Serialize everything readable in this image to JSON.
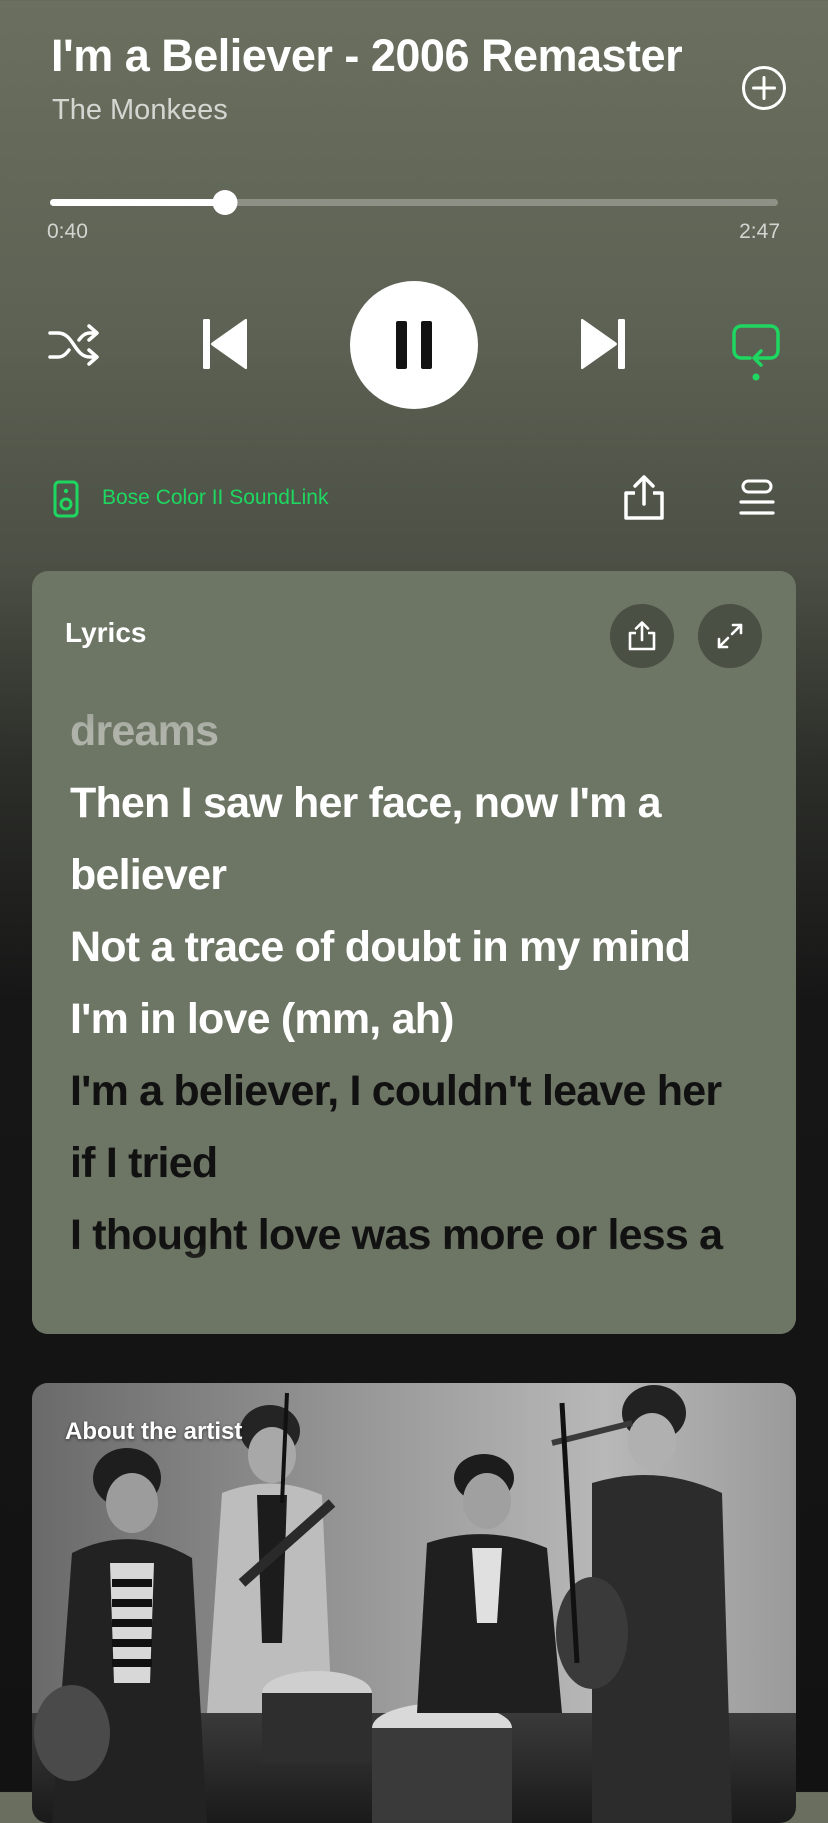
{
  "track": {
    "title": "I'm a Believer - 2006 Remaster",
    "artist": "The Monkees"
  },
  "progress": {
    "elapsed": "0:40",
    "total": "2:47",
    "fraction": 0.24
  },
  "controls": {
    "shuffle_icon": "shuffle-icon",
    "previous_icon": "skip-previous-icon",
    "play_state_icon": "pause-icon",
    "next_icon": "skip-next-icon",
    "repeat_icon": "repeat-icon",
    "repeat_active": true
  },
  "device": {
    "name": "Bose Color II SoundLink",
    "icon": "speaker-icon"
  },
  "lyrics": {
    "title": "Lyrics",
    "lines": [
      {
        "text": "dreams",
        "state": "past"
      },
      {
        "text": "Then I saw her face, now I'm a",
        "state": "sung"
      },
      {
        "text": "believer",
        "state": "sung"
      },
      {
        "text": "Not a trace of doubt in my mind",
        "state": "sung"
      },
      {
        "text": "I'm in love (mm, ah)",
        "state": "sung"
      },
      {
        "text": "I'm a believer, I couldn't leave her",
        "state": "upcoming"
      },
      {
        "text": "if I tried",
        "state": "upcoming"
      },
      {
        "text": "I thought love was more or less a",
        "state": "upcoming"
      }
    ]
  },
  "about_artist": {
    "title": "About the artist"
  },
  "colors": {
    "accent": "#1ed760",
    "lyrics_card": "#6d7565",
    "background_top": "#6a6f5f",
    "background_bottom": "#121212"
  }
}
